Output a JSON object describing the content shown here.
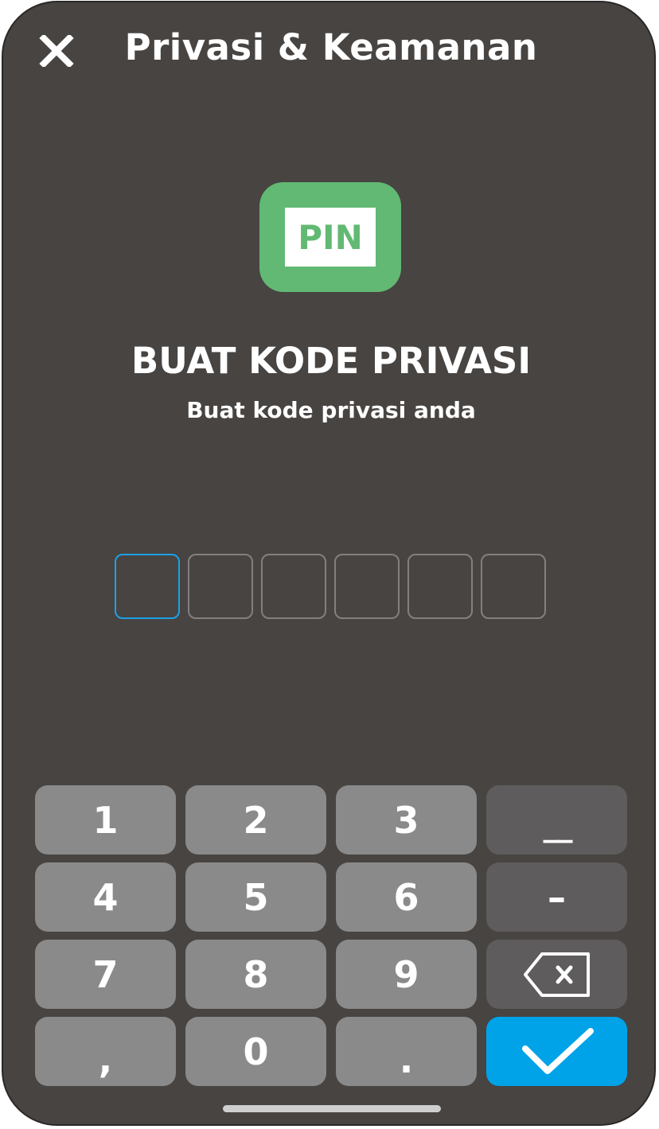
{
  "header": {
    "title": "Privasi & Keamanan",
    "close_icon": "close-icon"
  },
  "badge": {
    "text": "PIN",
    "color": "#62b973"
  },
  "main": {
    "title": "BUAT KODE PRIVASI",
    "subtitle": "Buat kode privasi anda"
  },
  "pin": {
    "length": 6,
    "active_index": 0,
    "active_color": "#1ea0e6"
  },
  "keypad": {
    "keys": [
      {
        "label": "1",
        "type": "digit"
      },
      {
        "label": "2",
        "type": "digit"
      },
      {
        "label": "3",
        "type": "digit"
      },
      {
        "label": "__",
        "type": "underscore"
      },
      {
        "label": "4",
        "type": "digit"
      },
      {
        "label": "5",
        "type": "digit"
      },
      {
        "label": "6",
        "type": "digit"
      },
      {
        "label": "–",
        "type": "dash"
      },
      {
        "label": "7",
        "type": "digit"
      },
      {
        "label": "8",
        "type": "digit"
      },
      {
        "label": "9",
        "type": "digit"
      },
      {
        "label": "",
        "type": "backspace",
        "icon": "backspace-icon"
      },
      {
        "label": ",",
        "type": "digit"
      },
      {
        "label": "0",
        "type": "digit"
      },
      {
        "label": ".",
        "type": "digit"
      },
      {
        "label": "",
        "type": "confirm",
        "icon": "checkmark-icon"
      }
    ],
    "confirm_color": "#00a2e8"
  }
}
